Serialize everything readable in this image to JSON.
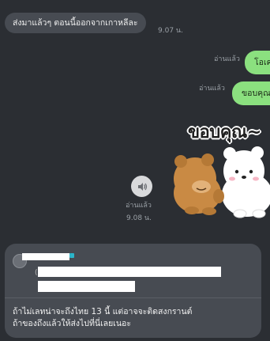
{
  "chat": {
    "incoming_message": "ส่งมาแล้วๆ ตอนนี้ออกจากเกาหลีละ",
    "incoming_time": "9.07 น.",
    "outgoing": [
      {
        "text": "โอเค",
        "read": "อ่านแล้ว"
      },
      {
        "text": "ขอบคุณ",
        "read": "อ่านแล้ว"
      }
    ],
    "sticker": {
      "caption": "ขอบคุณ~",
      "description": "brown-bear-and-white-bear-sticker",
      "read": "อ่านแล้ว",
      "time": "9.08 น.",
      "sound_icon": "speaker-icon"
    },
    "reply": {
      "quoted_marker": "(",
      "message_line1": "ถ้าไม่เลทน่าจะถึงไทย 13 นี้ แต่อาจจะติดสงกรานต์",
      "message_line2": "ถ้าของถึงแล้วให้ส่งไปที่นี่เลยเนอะ"
    }
  },
  "colors": {
    "background": "#2b2e33",
    "incoming_bubble": "#474b52",
    "outgoing_bubble": "#8be07f"
  }
}
